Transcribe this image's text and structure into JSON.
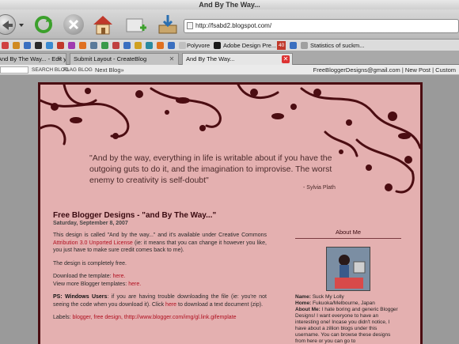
{
  "window": {
    "title": "And By The Way..."
  },
  "toolbar": {
    "url": "http://fsabd2.blogspot.com/",
    "buttons": [
      "back-icon",
      "reload-icon",
      "stop-icon",
      "home-icon",
      "new-tab-icon",
      "downloads-icon"
    ]
  },
  "bookmarks": [
    {
      "label": "Polyvore"
    },
    {
      "label": "Adobe Design Pre..."
    },
    {
      "label": "Statistics of suckm..."
    }
  ],
  "bookmark_badge": "40",
  "tabs": [
    {
      "label": "And By The Way... - Edit y..."
    },
    {
      "label": "Submit Layout - CreateBlog"
    },
    {
      "label": "And By The Way..."
    }
  ],
  "blogger_bar": {
    "search": "SEARCH BLOG",
    "flag": "FLAG BLOG",
    "next": "Next Blog»",
    "email": "FreeBloggerDesigns@gmail.com",
    "new_post": "New Post",
    "customize": "Custom"
  },
  "quote": {
    "text": "\"And by the way, everything in life is writable about if you have the outgoing  guts to do it, and the imagination to improvise.  The worst enemy to creativity is self-doubt\"",
    "author": "- Sylvia Plath"
  },
  "post": {
    "title": "Free Blogger Designs - \"and By The Way...\"",
    "date": "Saturday, September 8, 2007",
    "p1_a": "This design is called \"And by the way...\" and it's available under Creative Commons",
    "p1_link": "Attribution 3.0 Unported License",
    "p1_b": "(ie: it means that you can change it however you like, you just have to make sure credit comes back to me).",
    "p2": "The design is completely free.",
    "p3_a": "Download the template:",
    "p3_link1": "here.",
    "p3_b": "View more Blogger templates:",
    "p3_link2": "here.",
    "p4_label": "PS: Windows Users",
    "p4_a": ": if you are having trouble downloading the file (ie: you're not seeing the code when you download it). Click",
    "p4_link": "here",
    "p4_b": "to download a text document (zip).",
    "labels_label": "Labels:",
    "labels_links": "blogger, free design, thttp://www.blogger.com/img/gl.link.gifemplate"
  },
  "sidebar": {
    "title": "About Me",
    "name_label": "Name:",
    "name": "Suck My Lolly",
    "home_label": "Home:",
    "home": "Fukuoka/Melbourne, Japan",
    "about_label": "About Me:",
    "about": "I hate boring and generic Blogger Designs! I want everyone to have an interesting one! Incase you didn't notice, I have about a zillion blogs under this username. You can browse these designs from here or you can go to"
  }
}
